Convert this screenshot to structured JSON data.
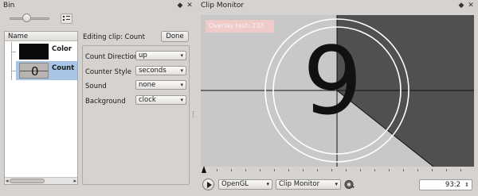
{
  "bin": {
    "title": "Bin",
    "tree_header": "Name",
    "items": [
      {
        "label": "Color",
        "thumb_color": "#0a0a0a"
      },
      {
        "label": "Count",
        "thumb_text": "0"
      }
    ]
  },
  "edit": {
    "title": "Editing clip: Count",
    "done": "Done",
    "fields": [
      {
        "label": "Count Direction",
        "value": "up"
      },
      {
        "label": "Counter Style",
        "value": "seconds"
      },
      {
        "label": "Sound",
        "value": "none"
      },
      {
        "label": "Background",
        "value": "clock"
      }
    ]
  },
  "monitor": {
    "title": "Clip Monitor",
    "overlay_text": "Overlay test: 233",
    "counter_digit": "9",
    "renderer": "OpenGL",
    "monitor_select": "Clip Monitor",
    "timecode": "93:2"
  },
  "icons": {
    "float": "◆",
    "close": "✕",
    "caret": "▾",
    "gear": "gear-icon"
  }
}
